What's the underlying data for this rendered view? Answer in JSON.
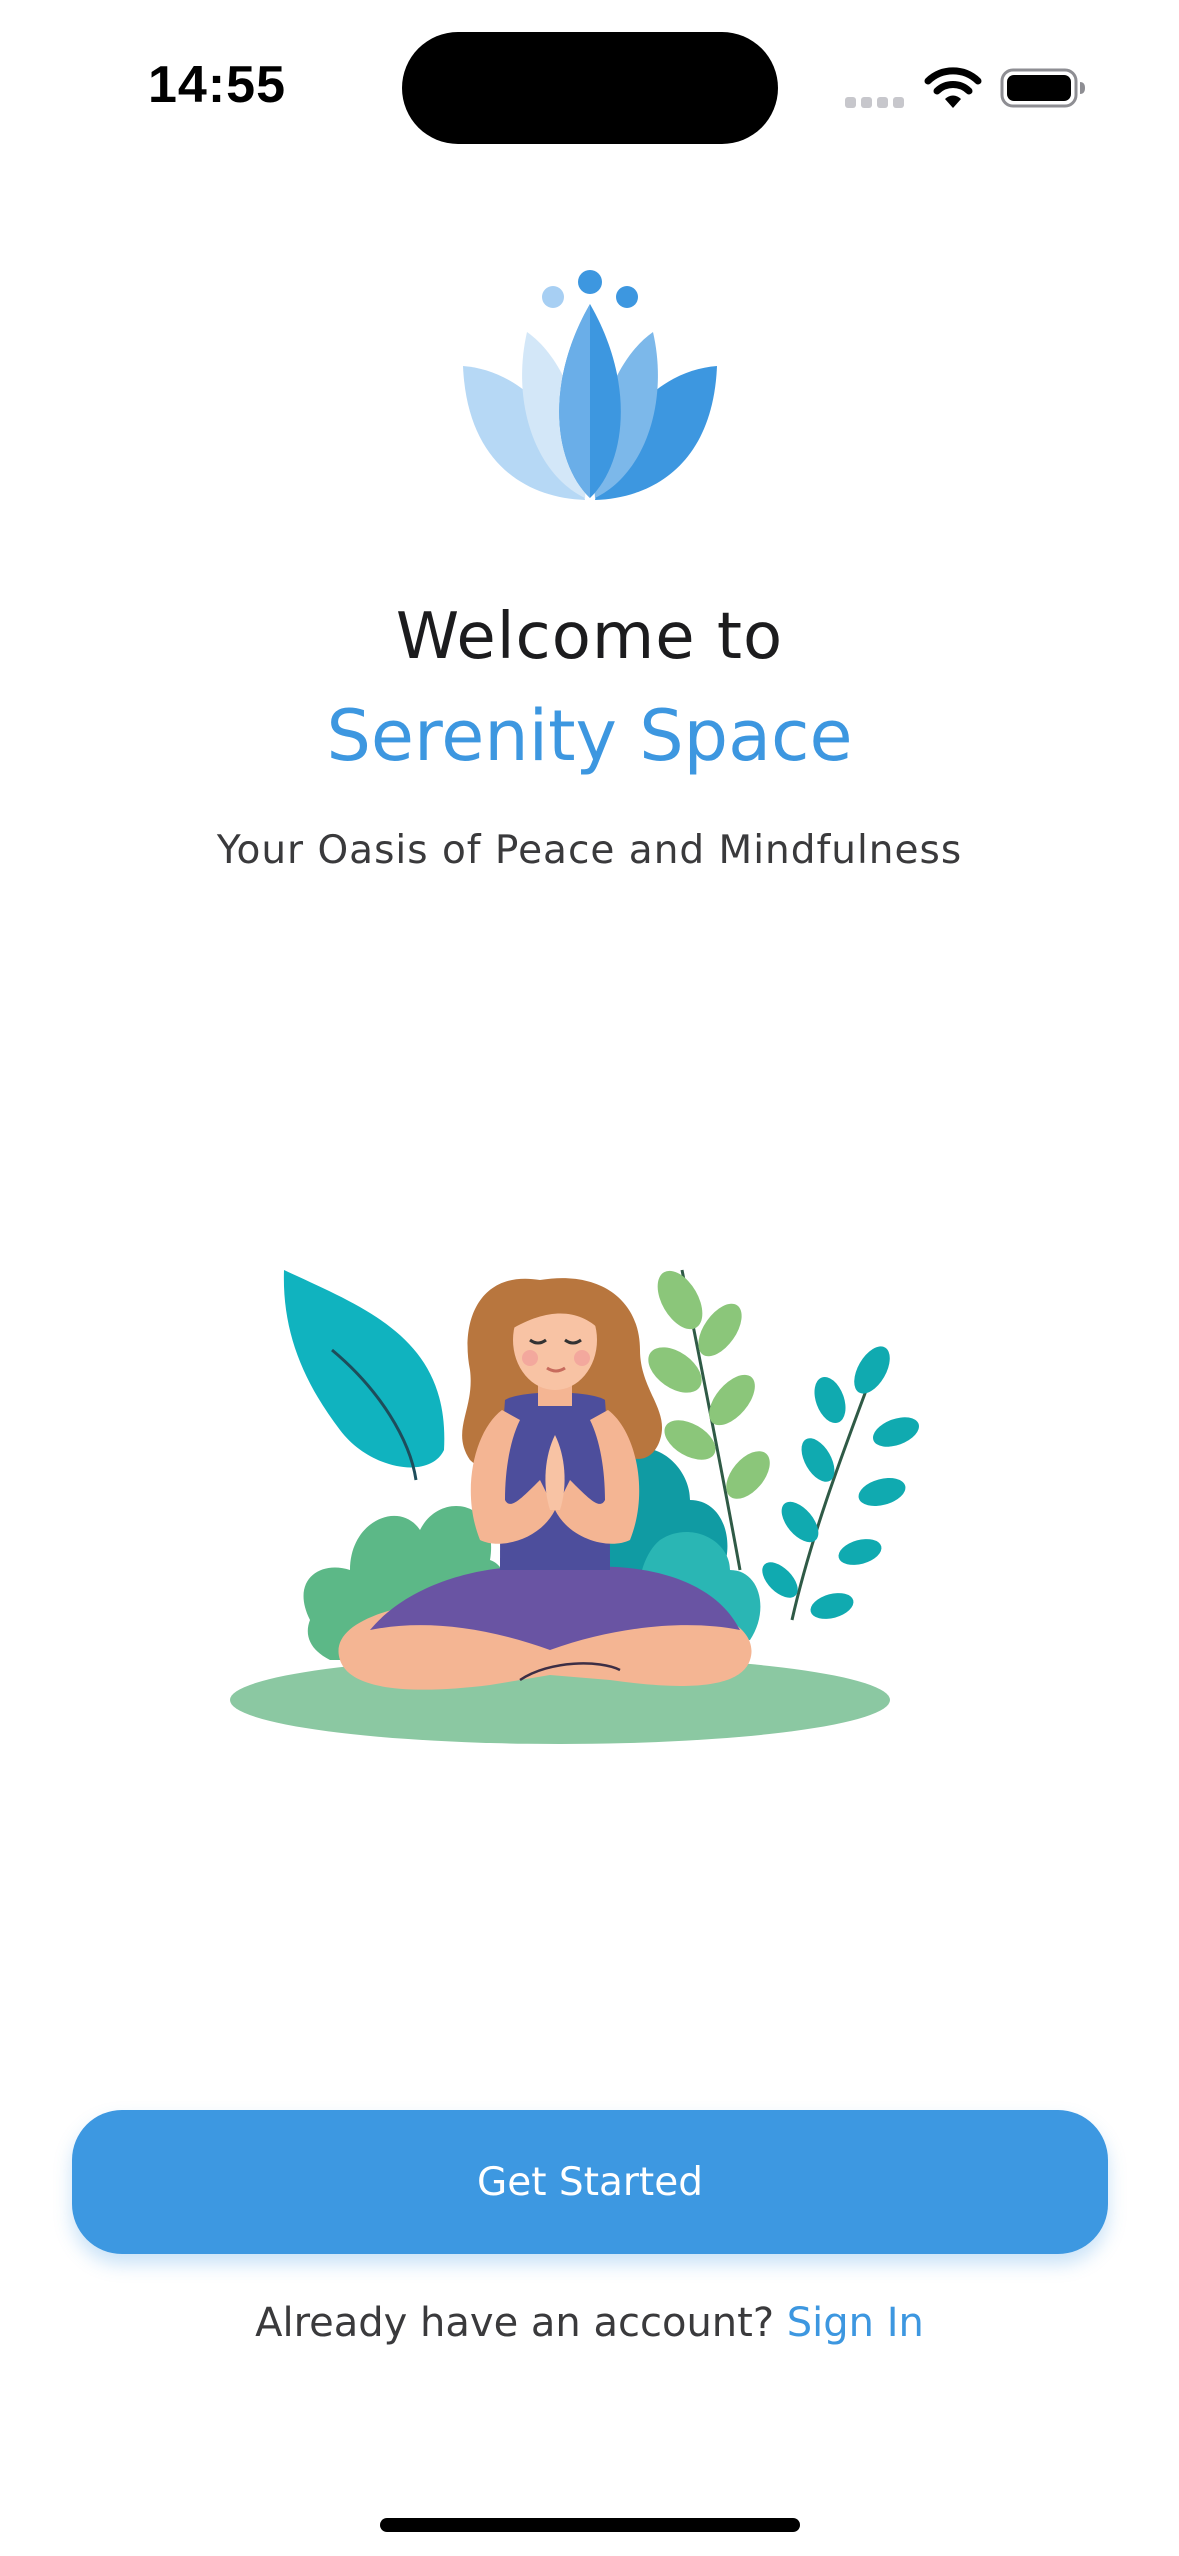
{
  "status_bar": {
    "time": "14:55",
    "icons": [
      "cellular-signal-icon",
      "wifi-icon",
      "battery-icon"
    ]
  },
  "logo": {
    "icon": "lotus-icon"
  },
  "welcome": {
    "line1": "Welcome to",
    "app_name": "Serenity Space",
    "tagline": "Your Oasis of Peace and Mindfulness"
  },
  "illustration": {
    "icon": "meditating-woman-illustration"
  },
  "actions": {
    "primary_label": "Get Started",
    "signin_prompt": "Already have an account?",
    "signin_link": "Sign In"
  },
  "colors": {
    "accent": "#3d97e0",
    "button": "#3d98e1",
    "text": "#1c1c1e",
    "muted": "#3a3a3c"
  }
}
